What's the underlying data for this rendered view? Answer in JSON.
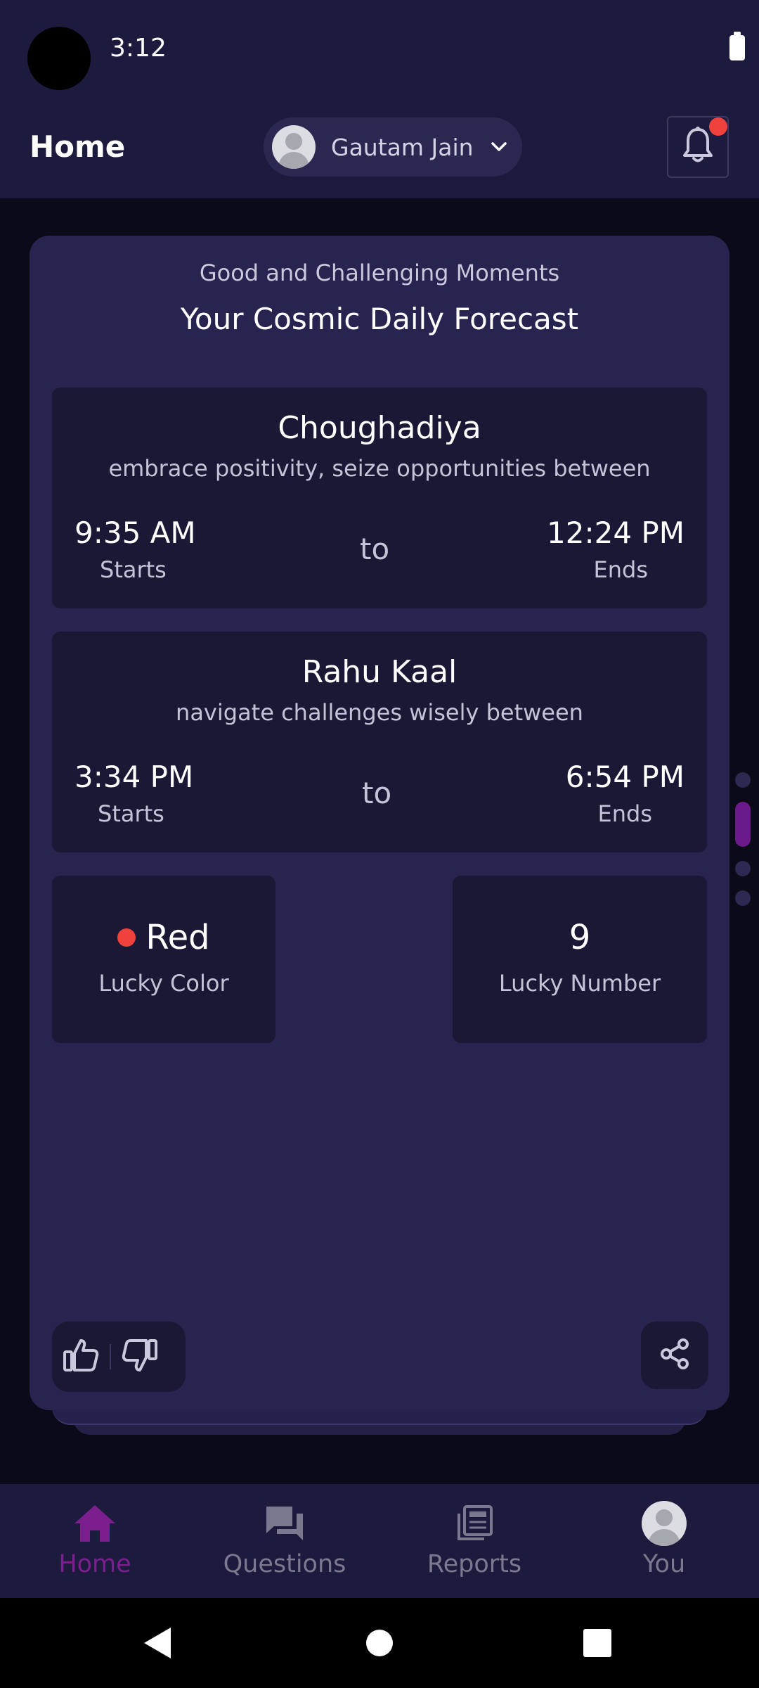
{
  "status_bar": {
    "time": "3:12"
  },
  "app_bar": {
    "title": "Home",
    "user_name": "Gautam Jain"
  },
  "card": {
    "subtitle": "Good and Challenging Moments",
    "title": "Your Cosmic Daily Forecast",
    "choughadiya": {
      "title": "Choughadiya",
      "description": "embrace positivity, seize opportunities between",
      "start_time": "9:35 AM",
      "start_label": "Starts",
      "to_label": "to",
      "end_time": "12:24 PM",
      "end_label": "Ends"
    },
    "rahu_kaal": {
      "title": "Rahu Kaal",
      "description": "navigate challenges wisely between",
      "start_time": "3:34 PM",
      "start_label": "Starts",
      "to_label": "to",
      "end_time": "6:54 PM",
      "end_label": "Ends"
    },
    "lucky_color": {
      "value": "Red",
      "label": "Lucky Color",
      "swatch": "#f0413c"
    },
    "lucky_number": {
      "value": "9",
      "label": "Lucky Number"
    }
  },
  "pager": {
    "count": 4,
    "active_index": 1
  },
  "bottom_nav": [
    {
      "label": "Home",
      "icon": "home-icon",
      "active": true
    },
    {
      "label": "Questions",
      "icon": "chat-icon",
      "active": false
    },
    {
      "label": "Reports",
      "icon": "newspaper-icon",
      "active": false
    },
    {
      "label": "You",
      "icon": "avatar-icon",
      "active": false
    }
  ],
  "colors": {
    "background": "#0b0a18",
    "bar": "#1c1a3d",
    "card": "#27254f",
    "tile": "#1a1834",
    "accent": "#7b1f8f",
    "notification": "#f0413c"
  }
}
